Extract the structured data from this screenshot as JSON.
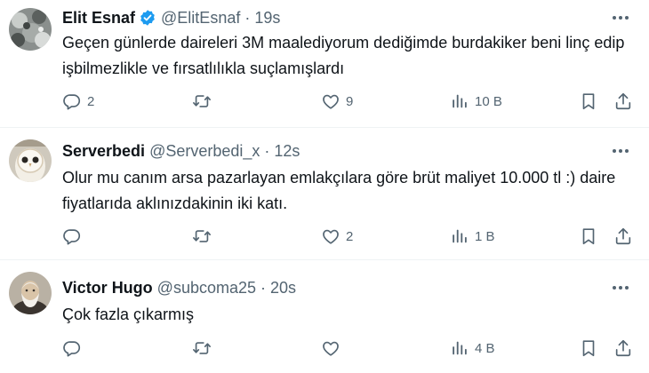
{
  "tweets": [
    {
      "display_name": "Elit Esnaf",
      "verified": true,
      "handle": "@ElitEsnaf",
      "separator": "·",
      "time": "19s",
      "text": "Geçen günlerde daireleri 3M maalediyorum dediğimde burdakiker beni linç edip işbilmezlikle ve fırsatlılıkla suçlamışlardı",
      "replies": "2",
      "retweets": "",
      "likes": "9",
      "views": "10 B",
      "avatar": "gray-textured-avatar"
    },
    {
      "display_name": "Serverbedi",
      "verified": false,
      "handle": "@Serverbedi_x",
      "separator": "·",
      "time": "12s",
      "text": "Olur mu canım arsa pazarlayan emlakçılara göre brüt maliyet 10.000 tl :) daire fiyatlarıda aklınızdakinin iki katı.",
      "replies": "",
      "retweets": "",
      "likes": "2",
      "views": "1 B",
      "avatar": "owl-avatar"
    },
    {
      "display_name": "Victor Hugo",
      "verified": false,
      "handle": "@subcoma25",
      "separator": "·",
      "time": "20s",
      "text": "Çok fazla çıkarmış",
      "replies": "",
      "retweets": "",
      "likes": "",
      "views": "4 B",
      "avatar": "bearded-man-avatar"
    }
  ],
  "colors": {
    "text_primary": "#0f1419",
    "text_secondary": "#536471",
    "verified_blue": "#1d9bf0",
    "divider": "#eff3f4"
  },
  "icons": [
    "more-icon",
    "reply-icon",
    "retweet-icon",
    "like-icon",
    "views-icon",
    "bookmark-icon",
    "share-icon",
    "verified-badge-icon"
  ]
}
